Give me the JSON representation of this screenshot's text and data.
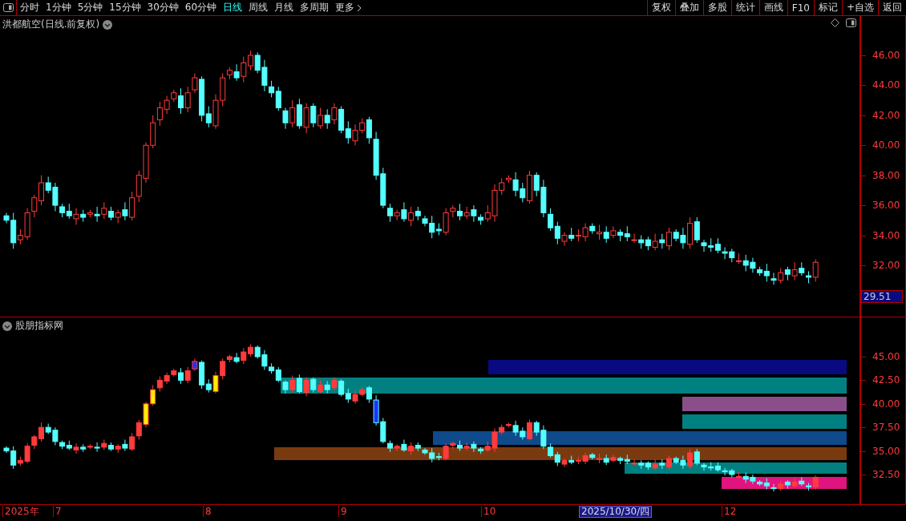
{
  "toolbar": {
    "periods": [
      {
        "label": "分时",
        "selected": false
      },
      {
        "label": "1分钟",
        "selected": false
      },
      {
        "label": "5分钟",
        "selected": false
      },
      {
        "label": "15分钟",
        "selected": false
      },
      {
        "label": "30分钟",
        "selected": false
      },
      {
        "label": "60分钟",
        "selected": false
      },
      {
        "label": "日线",
        "selected": true
      },
      {
        "label": "周线",
        "selected": false
      },
      {
        "label": "月线",
        "selected": false
      },
      {
        "label": "多周期",
        "selected": false
      }
    ],
    "more": "更多",
    "actions": [
      "复权",
      "叠加",
      "多股",
      "统计",
      "画线",
      "F10",
      "标记",
      "+自选",
      "返回"
    ]
  },
  "main_chart": {
    "title": "洪都航空(日线.前复权)",
    "y_ticks": [
      "46.00",
      "44.00",
      "42.00",
      "40.00",
      "38.00",
      "36.00",
      "34.00",
      "32.00"
    ],
    "current_price": "29.51"
  },
  "indicator": {
    "title": "股朋指标网",
    "y_ticks": [
      "45.00",
      "42.50",
      "40.00",
      "37.50",
      "35.00",
      "32.50"
    ]
  },
  "date_axis": {
    "labels": [
      "2025年",
      "7",
      "8",
      "9",
      "10",
      "12"
    ],
    "cursor_date": "2025/10/30/四"
  }
}
